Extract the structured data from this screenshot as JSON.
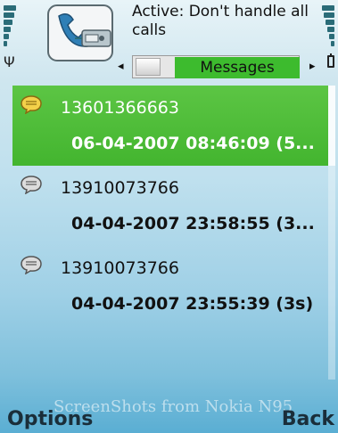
{
  "status": {
    "profile_text": "Active: Don't handle all calls",
    "tab_label": "Messages",
    "tab_left_arrow": "◂",
    "tab_right_arrow": "▸"
  },
  "messages": [
    {
      "number": "13601366663",
      "datetime": "06-04-2007 08:46:09 (5...",
      "selected": true
    },
    {
      "number": "13910073766",
      "datetime": "04-04-2007 23:58:55 (3...",
      "selected": false
    },
    {
      "number": "13910073766",
      "datetime": "04-04-2007 23:55:39 (3s)",
      "selected": false
    }
  ],
  "watermark": "ScreenShots from Nokia N95",
  "softkeys": {
    "left": "Options",
    "right": "Back"
  },
  "icons": {
    "app": "call-divert-icon",
    "message": "speech-bubble-icon",
    "signal": "antenna-icon",
    "battery": "battery-icon"
  },
  "colors": {
    "selection": "#43b52f",
    "active_tab": "#3dbb2e",
    "background": "#9fd0e6"
  }
}
